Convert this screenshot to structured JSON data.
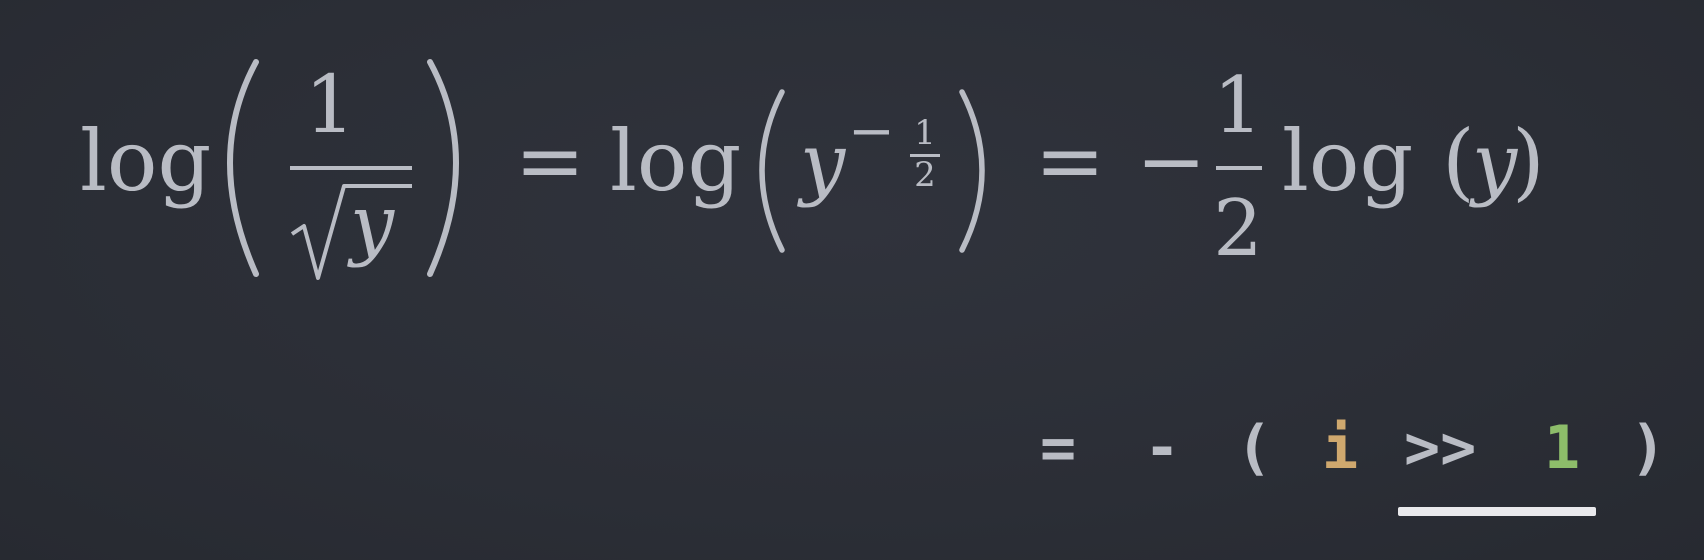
{
  "equation": {
    "lhs_fn": "log",
    "lhs_numerator": "1",
    "lhs_radicand": "y",
    "eq1": "=",
    "mid_fn": "log",
    "mid_base": "y",
    "mid_exp_sign": "−",
    "mid_exp_num": "1",
    "mid_exp_den": "2",
    "eq2": "=",
    "rhs_sign": "−",
    "rhs_num": "1",
    "rhs_den": "2",
    "rhs_fn": "log",
    "rhs_arg": "y"
  },
  "code": {
    "equals": "=",
    "minus": "-",
    "lparen": "(",
    "var": "i",
    "shift": ">>",
    "amount": "1",
    "rparen": ")"
  },
  "colors": {
    "background": "#2c2f37",
    "text": "#b9bcc4",
    "variable": "#cfa86e",
    "number": "#8dbd6a",
    "underline": "#e9e9ec"
  }
}
